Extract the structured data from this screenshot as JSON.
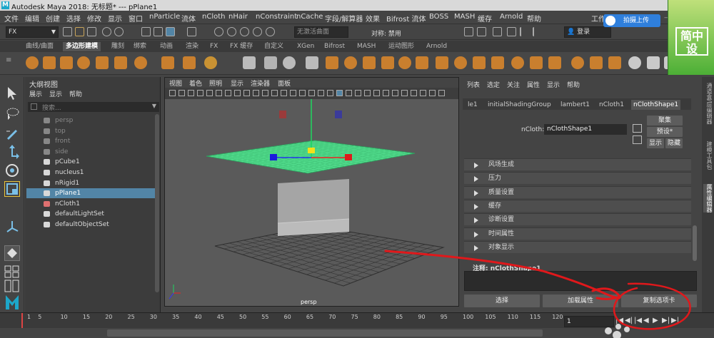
{
  "window": {
    "title": "Autodesk Maya 2018: 无标题*    ---    pPlane1",
    "logo_letter": "M"
  },
  "menubar": {
    "items": [
      "文件",
      "编辑",
      "创建",
      "选择",
      "修改",
      "显示",
      "窗口",
      "nParticle",
      "流体",
      "nCloth",
      "nHair",
      "nConstraint",
      "nCache",
      "字段/解算器",
      "效果",
      "Bifrost 流体",
      "BOSS",
      "MASH",
      "缓存",
      "Arnold",
      "帮助"
    ],
    "workspace_label": "工作"
  },
  "statusline": {
    "mode": "FX",
    "live_surface": "无激活曲面",
    "symmetry_label": "对称: 禁用",
    "login_label": "登录"
  },
  "overlays": {
    "baidu_button": "拍摄上传",
    "watermark": "简中设"
  },
  "shelf_tabs": {
    "items": [
      "曲线/曲面",
      "多边形建模",
      "雕刻",
      "绑索",
      "动画",
      "渲染",
      "FX",
      "FX 缓存",
      "自定义",
      "XGen",
      "Bifrost",
      "MASH",
      "运动图形",
      "Arnold"
    ],
    "active": "多边形建模"
  },
  "outliner": {
    "title": "大纲视图",
    "menu": [
      "展示",
      "显示",
      "帮助"
    ],
    "search_placeholder": "搜索...",
    "items": [
      {
        "name": "persp",
        "dim": true,
        "icon": "camera-icon"
      },
      {
        "name": "top",
        "dim": true,
        "icon": "camera-icon"
      },
      {
        "name": "front",
        "dim": true,
        "icon": "camera-icon"
      },
      {
        "name": "side",
        "dim": true,
        "icon": "camera-icon"
      },
      {
        "name": "pCube1",
        "dim": false,
        "icon": "mesh-icon"
      },
      {
        "name": "nucleus1",
        "dim": false,
        "icon": "nucleus-icon"
      },
      {
        "name": "nRigid1",
        "dim": false,
        "icon": "nrigid-icon"
      },
      {
        "name": "pPlane1",
        "dim": false,
        "icon": "mesh-icon",
        "selected": true
      },
      {
        "name": "nCloth1",
        "dim": false,
        "icon": "ncloth-icon"
      },
      {
        "name": "defaultLightSet",
        "dim": false,
        "icon": "set-icon"
      },
      {
        "name": "defaultObjectSet",
        "dim": false,
        "icon": "set-icon"
      }
    ]
  },
  "viewport": {
    "menu": [
      "视图",
      "着色",
      "照明",
      "显示",
      "渲染器",
      "面板"
    ],
    "camera_label": "persp"
  },
  "attribute_editor": {
    "menu": [
      "列表",
      "选定",
      "关注",
      "属性",
      "显示",
      "帮助"
    ],
    "tabs": [
      "le1",
      "initialShadingGroup",
      "lambert1",
      "nCloth1",
      "nClothShape1"
    ],
    "active_tab": "nClothShape1",
    "node_label": "nCloth:",
    "node_value": "nClothShape1",
    "buttons": {
      "focus": "聚集",
      "presets": "预设*",
      "show": "显示",
      "hide": "隐藏"
    },
    "sections": [
      "风场生成",
      "压力",
      "质量设置",
      "缓存",
      "诊断设置",
      "时间属性",
      "对象显示"
    ],
    "notes_label": "注释:  nClothShape1",
    "bottom_buttons": [
      "选择",
      "加载属性",
      "复制选项卡"
    ]
  },
  "side_tabs": [
    "通道盒/层编辑器",
    "建模工具包",
    "属性编辑器"
  ],
  "timeline": {
    "ticks": [
      "1",
      "5",
      "10",
      "15",
      "20",
      "25",
      "30",
      "35",
      "40",
      "45",
      "50",
      "55",
      "60",
      "65",
      "70",
      "75",
      "80",
      "85",
      "90",
      "95",
      "100",
      "105",
      "110",
      "115",
      "120"
    ],
    "current_frame": "1"
  },
  "colors": {
    "selection": "#5285a6",
    "cloth_green": "#53e08f",
    "accent_annotation": "#e0181b"
  }
}
